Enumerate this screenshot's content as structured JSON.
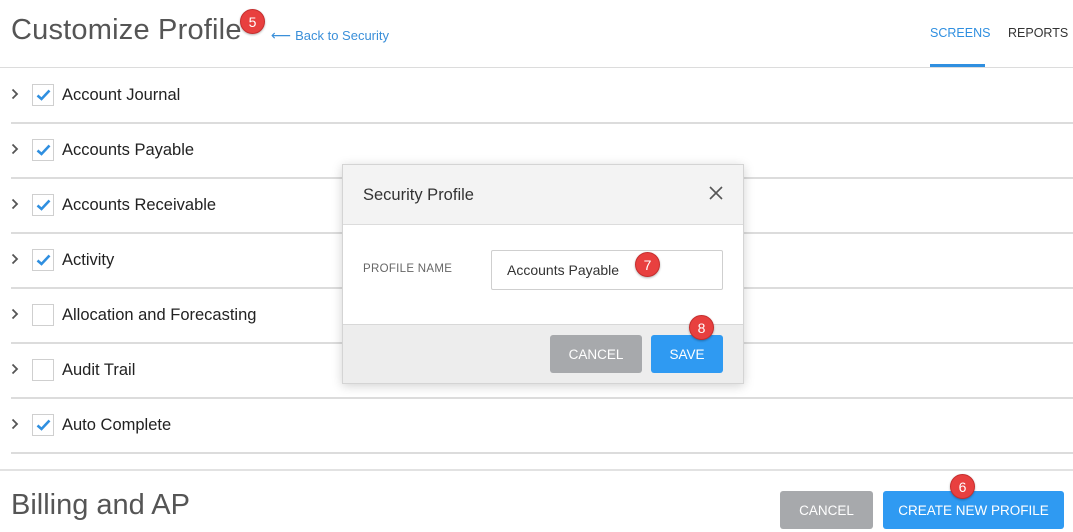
{
  "header": {
    "title": "Customize Profile",
    "back_link": "Back to Security",
    "tabs": [
      {
        "label": "SCREENS",
        "active": true
      },
      {
        "label": "REPORTS",
        "active": false
      }
    ]
  },
  "rows": [
    {
      "label": "Account Journal",
      "checked": true
    },
    {
      "label": "Accounts Payable",
      "checked": true
    },
    {
      "label": "Accounts Receivable",
      "checked": true
    },
    {
      "label": "Activity",
      "checked": true
    },
    {
      "label": "Allocation and Forecasting",
      "checked": false
    },
    {
      "label": "Audit Trail",
      "checked": false
    },
    {
      "label": "Auto Complete",
      "checked": true
    }
  ],
  "footer": {
    "title": "Billing and AP",
    "cancel_label": "CANCEL",
    "create_label": "CREATE NEW PROFILE"
  },
  "modal": {
    "title": "Security Profile",
    "field_label": "PROFILE NAME",
    "field_value": "Accounts Payable",
    "cancel_label": "CANCEL",
    "save_label": "SAVE"
  },
  "callouts": [
    "5",
    "6",
    "7",
    "8"
  ],
  "colors": {
    "accent": "#2f9af2",
    "link": "#3a8fd9",
    "gray_button": "#a7a9ac",
    "callout": "#e8403f",
    "check": "#2f8fe0"
  },
  "icons": {
    "back": "arrow-left-icon",
    "expand": "chevron-right-icon",
    "checked": "checkmark-icon",
    "close": "close-icon"
  }
}
